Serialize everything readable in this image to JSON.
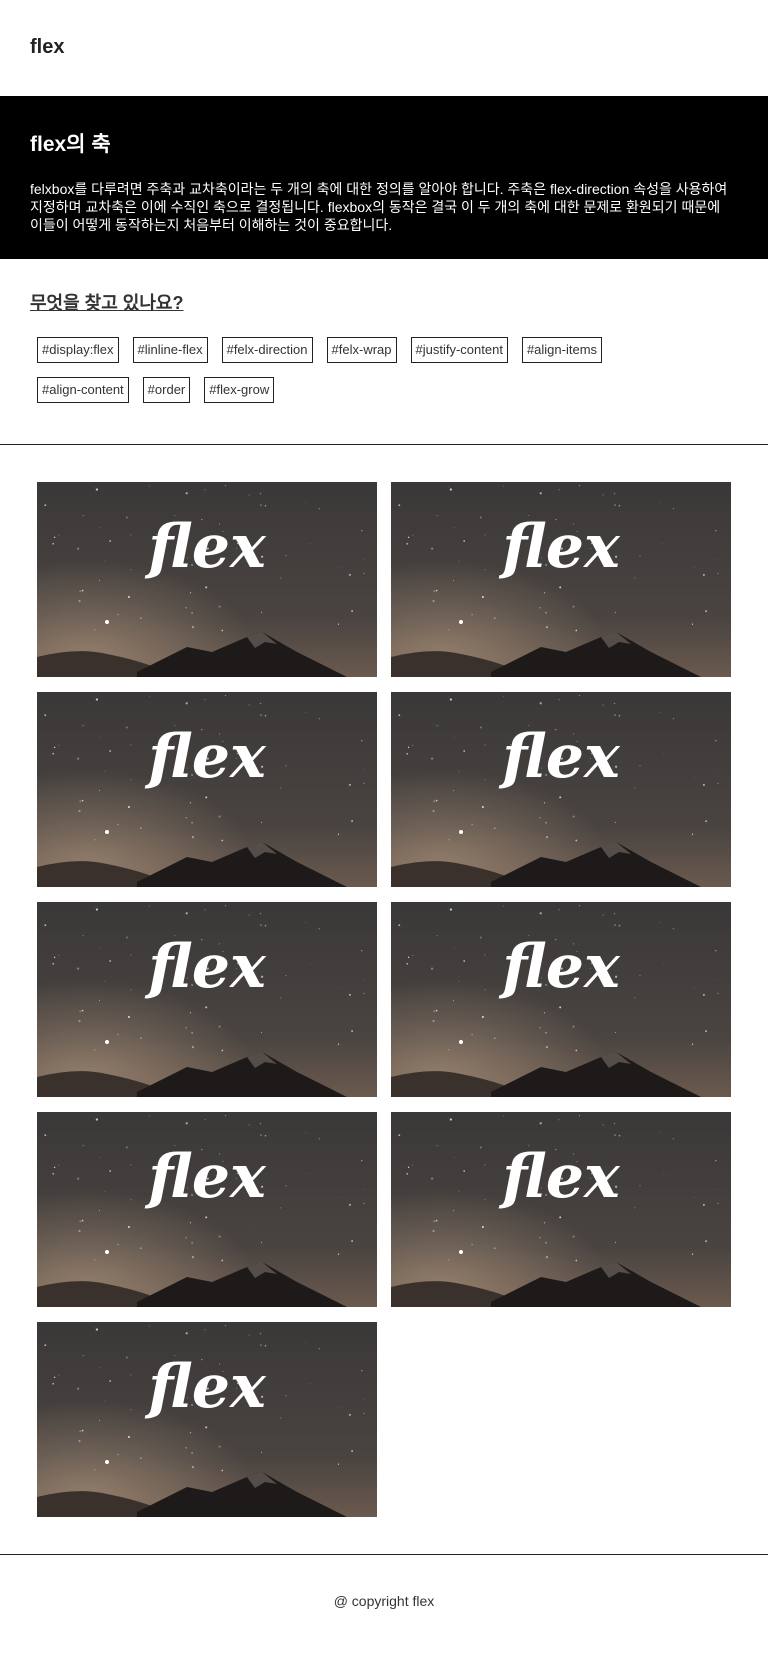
{
  "header": {
    "logo": "flex"
  },
  "hero": {
    "title": "flex의 축",
    "description": "felxbox를 다루려면 주축과 교차축이라는 두 개의 축에 대한 정의를 알아야 합니다. 주축은 flex-direction 속성을 사용하여 지정하며 교차축은 이에 수직인 축으로 결정됩니다. flexbox의 동작은 결국 이 두 개의 축에 대한 문제로 환원되기 때문에 이들이 어떻게 동작하는지 처음부터 이해하는 것이 중요합니다."
  },
  "search": {
    "title": "무엇을 찾고 있나요?",
    "tags": [
      "#display:flex",
      "#linline-flex",
      "#felx-direction",
      "#felx-wrap",
      "#justify-content",
      "#align-items",
      "#align-content",
      "#order",
      "#flex-grow"
    ]
  },
  "gallery": {
    "image_text": "flex",
    "image_count": 9,
    "colors": {
      "sky_top": "#3a3838",
      "sky_bottom": "#6b5a4e",
      "mountain": "#1e1a19",
      "text": "#ffffff"
    }
  },
  "footer": {
    "copyright": "@ copyright flex"
  }
}
